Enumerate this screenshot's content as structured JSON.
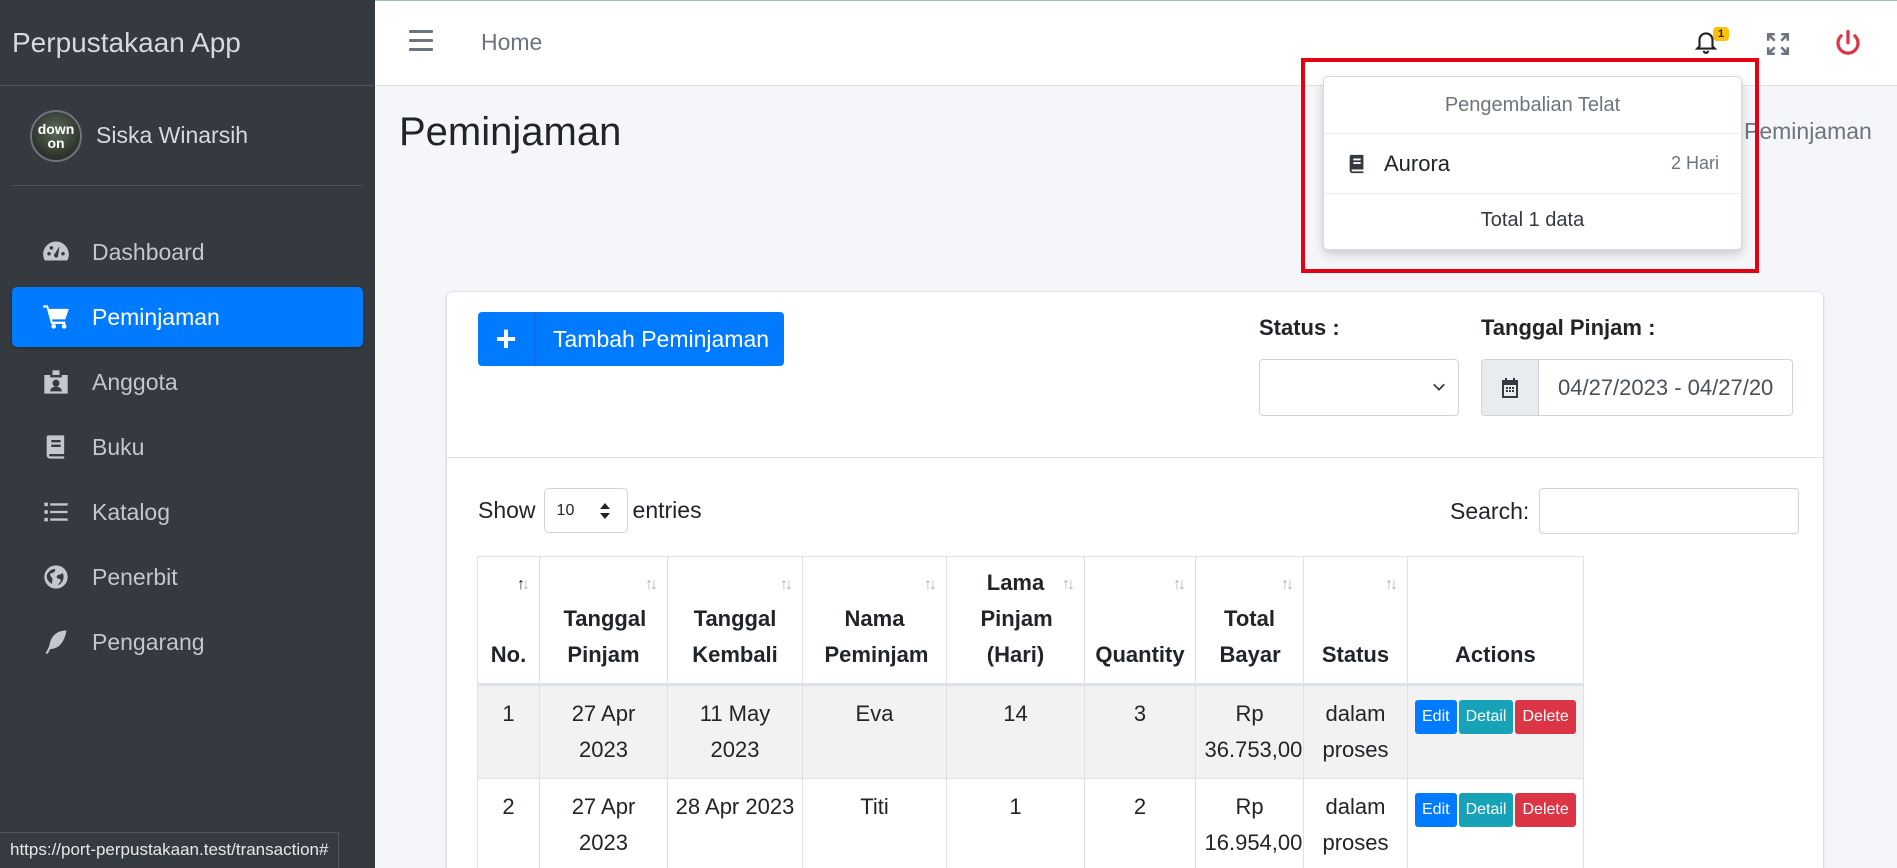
{
  "app": {
    "brand": "Perpustakaan App"
  },
  "user": {
    "name": "Siska Winarsih",
    "avatar_text": "down on"
  },
  "sidebar": {
    "items": [
      {
        "label": "Dashboard",
        "icon": "gauge-icon"
      },
      {
        "label": "Peminjaman",
        "icon": "cart-icon",
        "active": true
      },
      {
        "label": "Anggota",
        "icon": "id-badge-icon"
      },
      {
        "label": "Buku",
        "icon": "book-icon"
      },
      {
        "label": "Katalog",
        "icon": "list-icon"
      },
      {
        "label": "Penerbit",
        "icon": "globe-icon"
      },
      {
        "label": "Pengarang",
        "icon": "feather-icon"
      }
    ]
  },
  "topbar": {
    "home": "Home",
    "notif_count": "1"
  },
  "page": {
    "title": "Peminjaman",
    "breadcrumb_current": "Peminjaman"
  },
  "notifications": {
    "header": "Pengembalian Telat",
    "items": [
      {
        "title": "Aurora",
        "time": "2 Hari"
      }
    ],
    "footer": "Total 1 data"
  },
  "filters": {
    "add_button": "Tambah Peminjaman",
    "status_label": "Status :",
    "status_value": "",
    "date_label": "Tanggal Pinjam :",
    "date_value": "04/27/2023 - 04/27/20"
  },
  "table_controls": {
    "show": "Show",
    "entries_value": "10",
    "entries": "entries",
    "search_label": "Search:",
    "search_value": ""
  },
  "table": {
    "columns": [
      "No.",
      "Tanggal Pinjam",
      "Tanggal Kembali",
      "Nama Peminjam",
      "Lama Pinjam (Hari)",
      "Quantity",
      "Total Bayar",
      "Status",
      "Actions"
    ],
    "rows": [
      {
        "no": "1",
        "tgl_pinjam": "27 Apr 2023",
        "tgl_kembali": "11 May 2023",
        "nama": "Eva",
        "lama": "14",
        "qty": "3",
        "total": "Rp 36.753,00",
        "status": "dalam proses"
      },
      {
        "no": "2",
        "tgl_pinjam": "27 Apr 2023",
        "tgl_kembali": "28 Apr 2023",
        "nama": "Titi",
        "lama": "1",
        "qty": "2",
        "total": "Rp 16.954,00",
        "status": "dalam proses"
      }
    ],
    "actions": {
      "edit": "Edit",
      "detail": "Detail",
      "delete": "Delete"
    }
  },
  "status_bar": {
    "url": "https://port-perpustakaan.test/transaction#"
  },
  "colors": {
    "primary": "#007bff",
    "info": "#17a2b8",
    "danger": "#dc3545",
    "sidebar": "#343a40",
    "highlight_box": "#e60012"
  }
}
